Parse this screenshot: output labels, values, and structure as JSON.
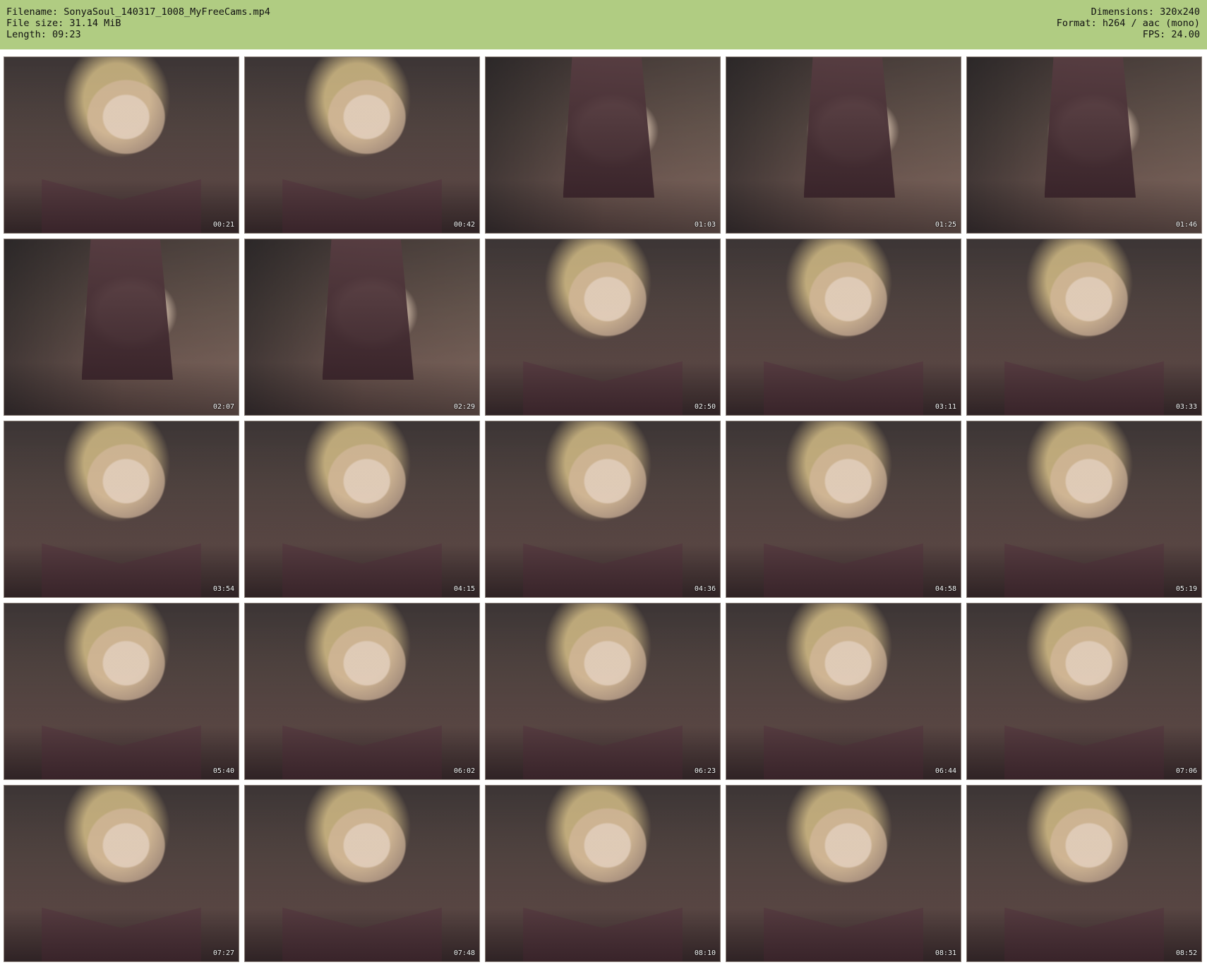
{
  "header": {
    "filename": "Filename: SonyaSoul_140317_1008_MyFreeCams.mp4",
    "file_size": "File size: 31.14 MiB",
    "length": "Length: 09:23",
    "dimensions": "Dimensions: 320x240",
    "format": "Format: h264 / aac (mono)",
    "fps": "FPS: 24.00"
  },
  "thumbnails": [
    {
      "time": "00:21"
    },
    {
      "time": "00:42"
    },
    {
      "time": "01:03"
    },
    {
      "time": "01:25"
    },
    {
      "time": "01:46"
    },
    {
      "time": "02:07"
    },
    {
      "time": "02:29"
    },
    {
      "time": "02:50"
    },
    {
      "time": "03:11"
    },
    {
      "time": "03:33"
    },
    {
      "time": "03:54"
    },
    {
      "time": "04:15"
    },
    {
      "time": "04:36"
    },
    {
      "time": "04:58"
    },
    {
      "time": "05:19"
    },
    {
      "time": "05:40"
    },
    {
      "time": "06:02"
    },
    {
      "time": "06:23"
    },
    {
      "time": "06:44"
    },
    {
      "time": "07:06"
    },
    {
      "time": "07:27"
    },
    {
      "time": "07:48"
    },
    {
      "time": "08:10"
    },
    {
      "time": "08:31"
    },
    {
      "time": "08:52"
    }
  ]
}
